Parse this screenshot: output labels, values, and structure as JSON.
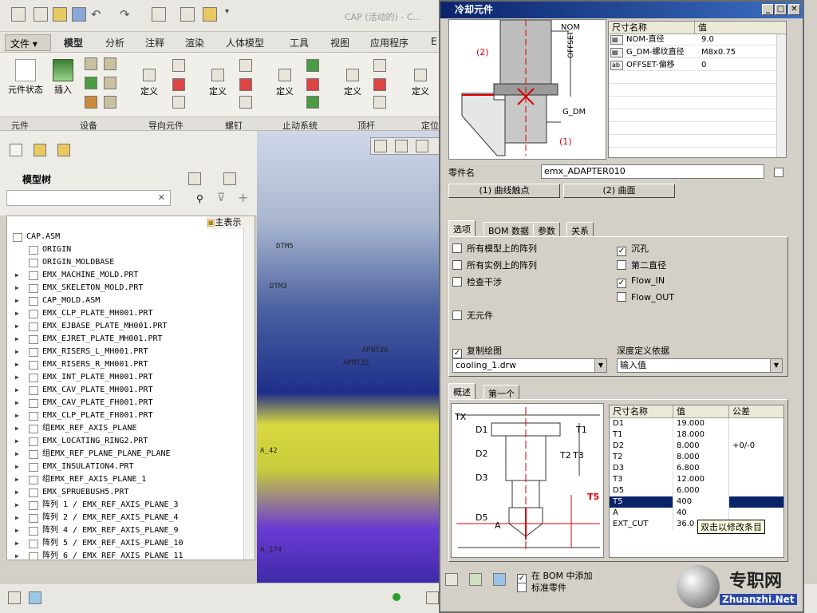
{
  "window": {
    "title": "CAP (活动的) - C..."
  },
  "tabs": [
    "文件",
    "模型",
    "分析",
    "注释",
    "渲染",
    "人体模型",
    "工具",
    "视图",
    "应用程序",
    "E"
  ],
  "ribbon": {
    "buttons": [
      "元件状态",
      "插入",
      "定义",
      "定义",
      "定义",
      "定义",
      "定义"
    ],
    "groups": [
      "元件",
      "设备",
      "导向元件",
      "螺钉",
      "止动系统",
      "顶杆",
      "定位"
    ]
  },
  "left_panel": {
    "title": "模型树",
    "show_label": "主表示",
    "tree": [
      {
        "label": "CAP.ASM",
        "expand": false
      },
      {
        "label": "ORIGIN",
        "expand": false
      },
      {
        "label": "ORIGIN_MOLDBASE",
        "expand": false
      },
      {
        "label": "EMX_MACHINE_MOLD.PRT",
        "expand": true
      },
      {
        "label": "EMX_SKELETON_MOLD.PRT",
        "expand": true
      },
      {
        "label": "CAP_MOLD.ASM",
        "expand": true
      },
      {
        "label": "EMX_CLP_PLATE_MH001.PRT",
        "expand": true
      },
      {
        "label": "EMX_EJBASE_PLATE_MH001.PRT",
        "expand": true
      },
      {
        "label": "EMX_EJRET_PLATE_MH001.PRT",
        "expand": true
      },
      {
        "label": "EMX_RISERS_L_MH001.PRT",
        "expand": true
      },
      {
        "label": "EMX_RISERS_R_MH001.PRT",
        "expand": true
      },
      {
        "label": "EMX_INT_PLATE_MH001.PRT",
        "expand": true
      },
      {
        "label": "EMX_CAV_PLATE_MH001.PRT",
        "expand": true
      },
      {
        "label": "EMX_CAV_PLATE_FH001.PRT",
        "expand": true
      },
      {
        "label": "EMX_CLP_PLATE_FH001.PRT",
        "expand": true
      },
      {
        "label": "组EMX_REF_AXIS_PLANE",
        "expand": true
      },
      {
        "label": "EMX_LOCATING_RING2.PRT",
        "expand": true
      },
      {
        "label": "组EMX_REF_PLANE_PLANE_PLANE",
        "expand": true
      },
      {
        "label": "EMX_INSULATION4.PRT",
        "expand": true
      },
      {
        "label": "组EMX_REF_AXIS_PLANE_1",
        "expand": true
      },
      {
        "label": "EMX_SPRUEBUSH5.PRT",
        "expand": true
      },
      {
        "label": "阵列 1 / EMX_REF_AXIS_PLANE_3",
        "expand": true
      },
      {
        "label": "阵列 2 / EMX_REF_AXIS_PLANE_4",
        "expand": true
      },
      {
        "label": "阵列 4 / EMX_REF_AXIS_PLANE_9",
        "expand": true
      },
      {
        "label": "阵列 5 / EMX_REF_AXIS_PLANE_10",
        "expand": true
      },
      {
        "label": "阵列 6 / EMX_REF_AXIS_PLANE_11",
        "expand": true
      }
    ]
  },
  "viewport": {
    "labels": [
      "DTM5",
      "DTM3",
      "APNT36",
      "APNT35",
      "A_42",
      "A_174"
    ]
  },
  "dialog": {
    "title": "冷却元件",
    "diagram_labels": {
      "nom": "NOM",
      "offset": "OFFSET",
      "g_dm": "G_DM",
      "ref1": "(1)",
      "ref2": "(2)"
    },
    "param_table": {
      "headers": [
        "尺寸名称",
        "值"
      ],
      "rows": [
        {
          "type": "dim",
          "name": "NOM-直径",
          "value": "9.0"
        },
        {
          "type": "dim",
          "name": "G_DM-螺纹直径",
          "value": "M8x0.75"
        },
        {
          "type": "ab",
          "name": "OFFSET-偏移",
          "value": "0"
        }
      ]
    },
    "part_name_label": "零件名",
    "part_name_value": "emx_ADAPTER010",
    "ref_buttons": [
      "(1) 曲线触点",
      "(2) 曲面"
    ],
    "tabs": [
      "选项",
      "BOM 数据",
      "参数",
      "关系"
    ],
    "options_left": [
      {
        "label": "所有模型上的阵列",
        "checked": false
      },
      {
        "label": "所有实例上的阵列",
        "checked": false
      },
      {
        "label": "检查干涉",
        "checked": false
      },
      {
        "label": "无元件",
        "checked": false
      }
    ],
    "options_right": [
      {
        "label": "沉孔",
        "checked": true
      },
      {
        "label": "第二直径",
        "checked": false
      },
      {
        "label": "Flow_IN",
        "checked": true
      },
      {
        "label": "Flow_OUT",
        "checked": false
      }
    ],
    "copy_drawing": {
      "label": "复制绘图",
      "checked": true,
      "value": "cooling_1.drw"
    },
    "depth": {
      "label": "深度定义依据",
      "value": "输入值"
    },
    "subtabs": [
      "概述",
      "第一个"
    ],
    "diagram2_labels": [
      "TX",
      "D1",
      "T1",
      "D2",
      "T2",
      "T3",
      "D3",
      "D5",
      "A",
      "T5"
    ],
    "dim_table": {
      "headers": [
        "尺寸名称",
        "值",
        "公差"
      ],
      "rows": [
        {
          "name": "D1",
          "value": "19.000",
          "tol": ""
        },
        {
          "name": "T1",
          "value": "18.000",
          "tol": ""
        },
        {
          "name": "D2",
          "value": "8.000",
          "tol": "+0/-0"
        },
        {
          "name": "T2",
          "value": "8.000",
          "tol": ""
        },
        {
          "name": "D3",
          "value": "6.800",
          "tol": ""
        },
        {
          "name": "T3",
          "value": "12.000",
          "tol": ""
        },
        {
          "name": "D5",
          "value": "6.000",
          "tol": ""
        },
        {
          "name": "T5",
          "value": "400",
          "tol": "",
          "selected": true
        },
        {
          "name": "A",
          "value": "40",
          "tol": ""
        },
        {
          "name": "EXT_CUT",
          "value": "36.0",
          "tol": ""
        }
      ]
    },
    "tooltip": "双击以修改条目",
    "footer": [
      {
        "label": "在 BOM 中添加",
        "checked": true
      },
      {
        "label": "标准零件",
        "checked": false
      }
    ]
  },
  "watermark": {
    "text": "专职网",
    "sub": "Zhuanzhi.Net"
  }
}
